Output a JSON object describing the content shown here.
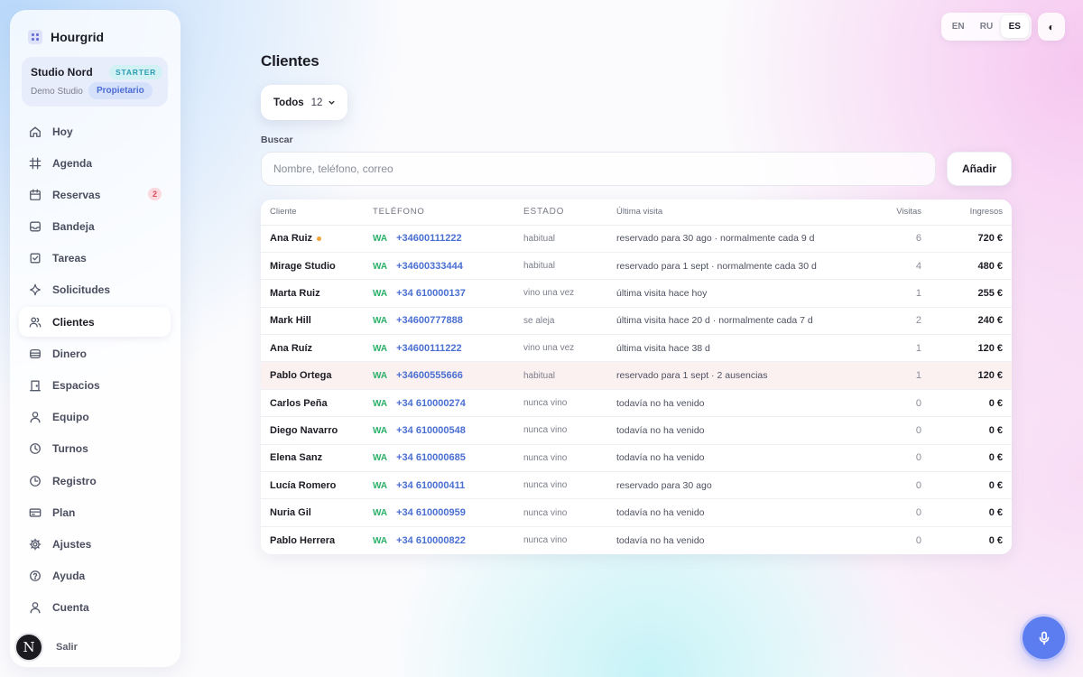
{
  "app": {
    "name": "Hourgrid"
  },
  "org": {
    "name": "Studio Nord",
    "plan_badge": "STARTER",
    "subtitle": "Demo Studio",
    "role": "Propietario"
  },
  "nav": [
    {
      "label": "Hoy",
      "icon": "home-icon"
    },
    {
      "label": "Agenda",
      "icon": "grid-icon"
    },
    {
      "label": "Reservas",
      "icon": "calendar-icon",
      "badge": "2"
    },
    {
      "label": "Bandeja",
      "icon": "inbox-icon"
    },
    {
      "label": "Tareas",
      "icon": "checkbox-icon"
    },
    {
      "label": "Solicitudes",
      "icon": "sparkle-icon"
    },
    {
      "label": "Clientes",
      "icon": "users-icon",
      "active": true
    },
    {
      "label": "Dinero",
      "icon": "wallet-icon"
    },
    {
      "label": "Espacios",
      "icon": "door-icon"
    },
    {
      "label": "Equipo",
      "icon": "person-icon"
    },
    {
      "label": "Turnos",
      "icon": "clock-icon"
    },
    {
      "label": "Registro",
      "icon": "history-icon"
    },
    {
      "label": "Plan",
      "icon": "card-icon"
    },
    {
      "label": "Ajustes",
      "icon": "gear-icon"
    },
    {
      "label": "Ayuda",
      "icon": "help-icon"
    },
    {
      "label": "Cuenta",
      "icon": "account-icon"
    }
  ],
  "logout": {
    "avatar_letter": "N",
    "label": "Salir"
  },
  "languages": [
    {
      "code": "EN"
    },
    {
      "code": "RU"
    },
    {
      "code": "ES",
      "active": true
    }
  ],
  "theme_toggle": {
    "glyph": "◐"
  },
  "page": {
    "title": "Clientes"
  },
  "filter": {
    "label": "Todos",
    "count": "12"
  },
  "search": {
    "label": "Buscar",
    "placeholder": "Nombre, teléfono, correo"
  },
  "add_button": "Añadir",
  "table": {
    "headers": {
      "client": "Cliente",
      "phone": "TELÉFONO",
      "status": "ESTADO",
      "last_visit": "Última visita",
      "visits": "Visitas",
      "income": "Ingresos"
    },
    "rows": [
      {
        "name": "Ana Ruiz",
        "dot": true,
        "wa": "WA",
        "phone": "+34600111222",
        "status": "habitual",
        "last": "reservado para 30 ago · normalmente cada 9 d",
        "visits": "6",
        "income": "720 €"
      },
      {
        "name": "Mirage Studio",
        "wa": "WA",
        "phone": "+34600333444",
        "status": "habitual",
        "last": "reservado para 1 sept · normalmente cada 30 d",
        "visits": "4",
        "income": "480 €"
      },
      {
        "name": "Marta Ruiz",
        "wa": "WA",
        "phone": "+34 610000137",
        "status": "vino una vez",
        "last": "última visita hace hoy",
        "visits": "1",
        "income": "255 €"
      },
      {
        "name": "Mark Hill",
        "wa": "WA",
        "phone": "+34600777888",
        "status": "se aleja",
        "last": "última visita hace 20 d · normalmente cada 7 d",
        "visits": "2",
        "income": "240 €"
      },
      {
        "name": "Ana Ruíz",
        "wa": "WA",
        "phone": "+34600111222",
        "status": "vino una vez",
        "last": "última visita hace 38 d",
        "visits": "1",
        "income": "120 €"
      },
      {
        "name": "Pablo Ortega",
        "highlight": true,
        "wa": "WA",
        "phone": "+34600555666",
        "status": "habitual",
        "last": "reservado para 1 sept · 2 ausencias",
        "visits": "1",
        "income": "120 €"
      },
      {
        "name": "Carlos Peña",
        "wa": "WA",
        "phone": "+34 610000274",
        "status": "nunca vino",
        "last": "todavía no ha venido",
        "visits": "0",
        "income": "0 €"
      },
      {
        "name": "Diego Navarro",
        "wa": "WA",
        "phone": "+34 610000548",
        "status": "nunca vino",
        "last": "todavía no ha venido",
        "visits": "0",
        "income": "0 €"
      },
      {
        "name": "Elena Sanz",
        "wa": "WA",
        "phone": "+34 610000685",
        "status": "nunca vino",
        "last": "todavía no ha venido",
        "visits": "0",
        "income": "0 €"
      },
      {
        "name": "Lucía Romero",
        "wa": "WA",
        "phone": "+34 610000411",
        "status": "nunca vino",
        "last": "reservado para 30 ago",
        "visits": "0",
        "income": "0 €"
      },
      {
        "name": "Nuria Gil",
        "wa": "WA",
        "phone": "+34 610000959",
        "status": "nunca vino",
        "last": "todavía no ha venido",
        "visits": "0",
        "income": "0 €"
      },
      {
        "name": "Pablo Herrera",
        "wa": "WA",
        "phone": "+34 610000822",
        "status": "nunca vino",
        "last": "todavía no ha venido",
        "visits": "0",
        "income": "0 €"
      }
    ]
  },
  "voice_button": {
    "icon": "microphone-icon"
  }
}
